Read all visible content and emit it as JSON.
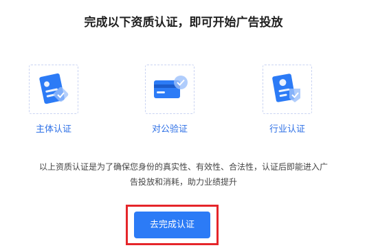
{
  "page": {
    "title": "完成以下资质认证，即可开始广告投放"
  },
  "certifications": [
    {
      "label": "主体认证",
      "icon": "id-card-icon"
    },
    {
      "label": "对公验证",
      "icon": "bank-card-icon"
    },
    {
      "label": "行业认证",
      "icon": "certificate-icon"
    }
  ],
  "description": {
    "line1": "以上资质认证是为了确保您身份的真实性、有效性、合法性，认证后即能进入广",
    "line2": "告投放和消耗，助力业绩提升"
  },
  "cta": {
    "label": "去完成认证"
  },
  "colors": {
    "accent": "#2c7bf6",
    "label": "#2c6fe6",
    "highlight": "#e5252a",
    "card_border": "#c9d3f2"
  }
}
